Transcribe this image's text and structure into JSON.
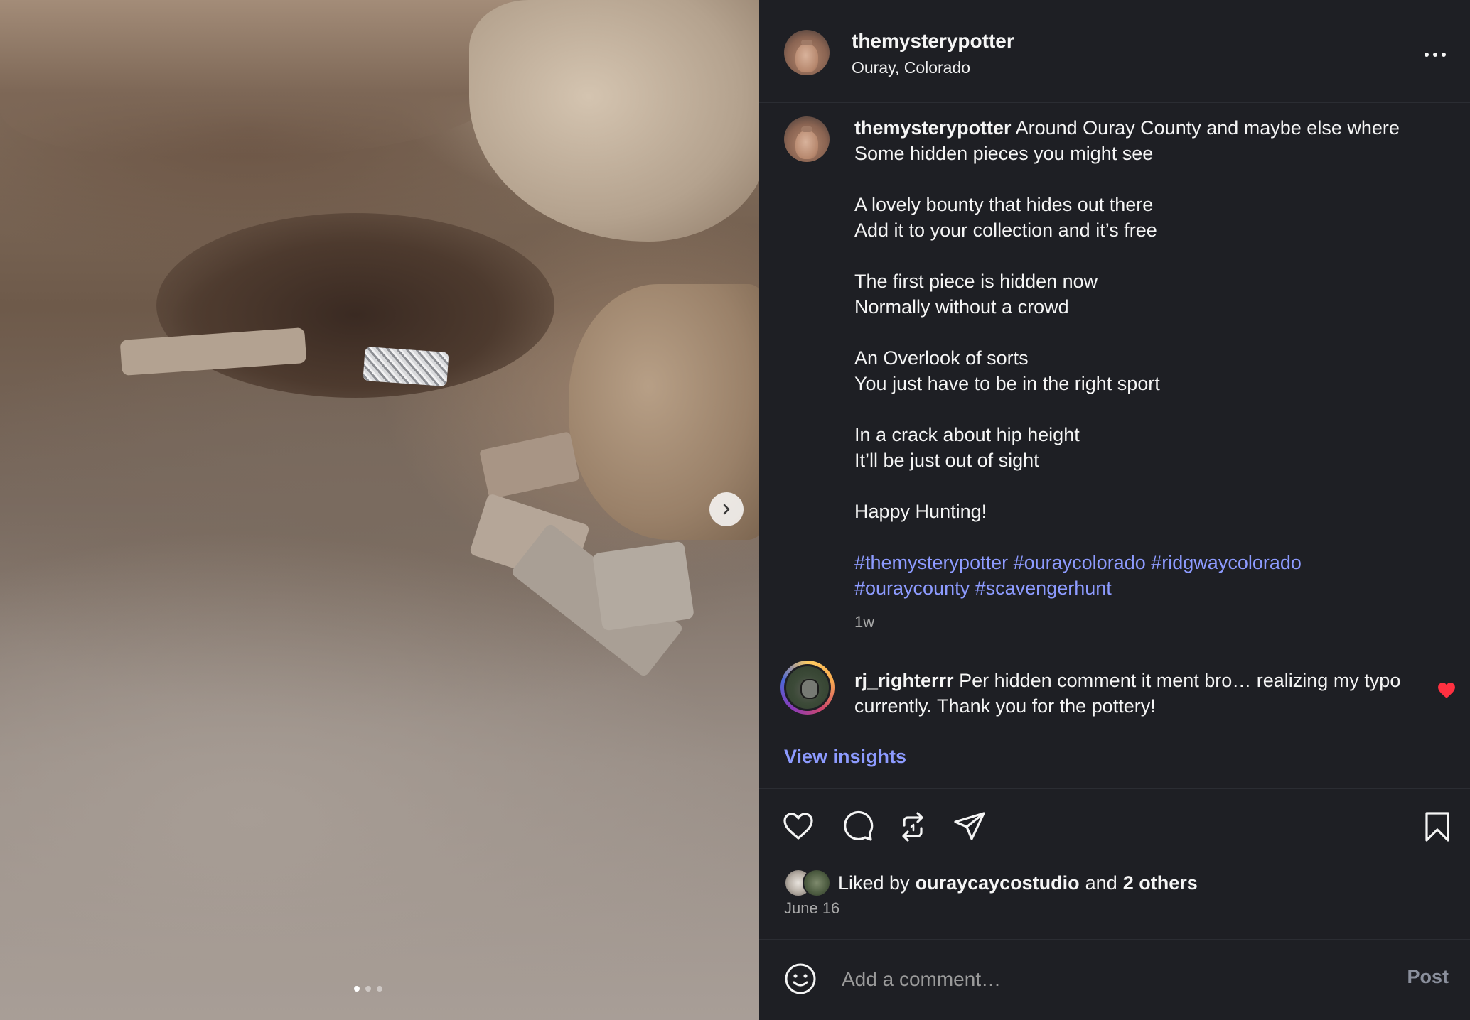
{
  "post": {
    "author": "themysterypotter",
    "location": "Ouray, Colorado",
    "caption_lines": [
      "Around Ouray County and maybe else where",
      "Some hidden pieces you might see",
      "A lovely bounty that hides out there",
      "Add it to your collection and it’s free",
      "The first piece is hidden now",
      "Normally without a crowd",
      "An Overlook of sorts",
      "You just have to be in the right sport",
      "In a crack about hip height",
      "It’ll be just out of sight",
      "Happy Hunting!"
    ],
    "hashtags": [
      "#themysterypotter",
      "#ouraycolorado",
      "#ridgwaycolorado",
      "#ouraycounty",
      "#scavengerhunt"
    ],
    "time_ago": "1w"
  },
  "comment": {
    "author": "rj_righterrr",
    "text": "Per hidden comment it ment bro… realizing my typo currently. Thank you for the pottery!"
  },
  "view_insights": "View insights",
  "likes": {
    "prefix": "Liked by",
    "user": "ouraycaycostudio",
    "joiner": "and",
    "others": "2 others"
  },
  "date": "June 16",
  "composer": {
    "placeholder": "Add a comment…",
    "post_label": "Post"
  },
  "carousel": {
    "current_slide": 1,
    "total_slides": 3
  },
  "colors": {
    "background": "#1e1f24",
    "link": "#8d9bff",
    "like_red": "#ff3040",
    "muted": "#a8a8a8"
  },
  "icons": [
    "more-options-icon",
    "chevron-right-icon",
    "heart-icon",
    "comment-icon",
    "repost-icon",
    "share-icon",
    "bookmark-icon",
    "emoji-icon",
    "heart-filled-icon"
  ]
}
